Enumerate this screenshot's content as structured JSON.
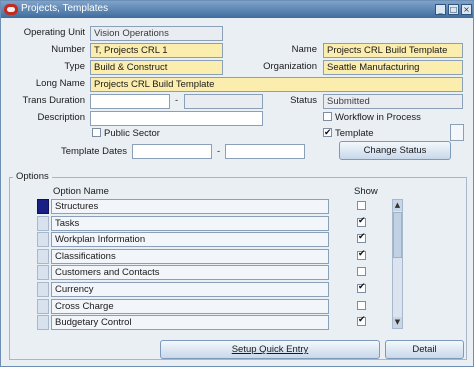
{
  "window": {
    "title": "Projects, Templates"
  },
  "header": {
    "operating_unit": {
      "label": "Operating Unit",
      "value": "Vision Operations"
    },
    "number": {
      "label": "Number",
      "value": "T, Projects CRL 1"
    },
    "name": {
      "label": "Name",
      "value": "Projects CRL Build Template"
    },
    "type": {
      "label": "Type",
      "value": "Build & Construct"
    },
    "organization": {
      "label": "Organization",
      "value": "Seattle Manufacturing"
    },
    "long_name": {
      "label": "Long Name",
      "value": "Projects CRL Build Template"
    },
    "trans_duration": {
      "label": "Trans Duration",
      "from": "",
      "separator": "-",
      "to": ""
    },
    "status": {
      "label": "Status",
      "value": "Submitted"
    },
    "description": {
      "label": "Description",
      "value": ""
    },
    "workflow_in_process": {
      "label": "Workflow in Process",
      "checked": false
    },
    "public_sector": {
      "label": "Public Sector",
      "checked": false
    },
    "template": {
      "label": "Template",
      "checked": true
    },
    "template_dates": {
      "label": "Template Dates",
      "from": "",
      "separator": "-",
      "to": ""
    },
    "change_status_button": "Change Status"
  },
  "options": {
    "section_label": "Options",
    "column_option_name": "Option Name",
    "column_show": "Show",
    "rows": [
      {
        "name": "Structures",
        "show": false
      },
      {
        "name": "Tasks",
        "show": true
      },
      {
        "name": "Workplan Information",
        "show": true
      },
      {
        "name": "Classifications",
        "show": true
      },
      {
        "name": "Customers and Contacts",
        "show": false
      },
      {
        "name": "Currency",
        "show": true
      },
      {
        "name": "Cross Charge",
        "show": false
      },
      {
        "name": "Budgetary Control",
        "show": true
      }
    ]
  },
  "footer": {
    "setup_quick_entry": "Setup Quick Entry",
    "detail": "Detail"
  }
}
